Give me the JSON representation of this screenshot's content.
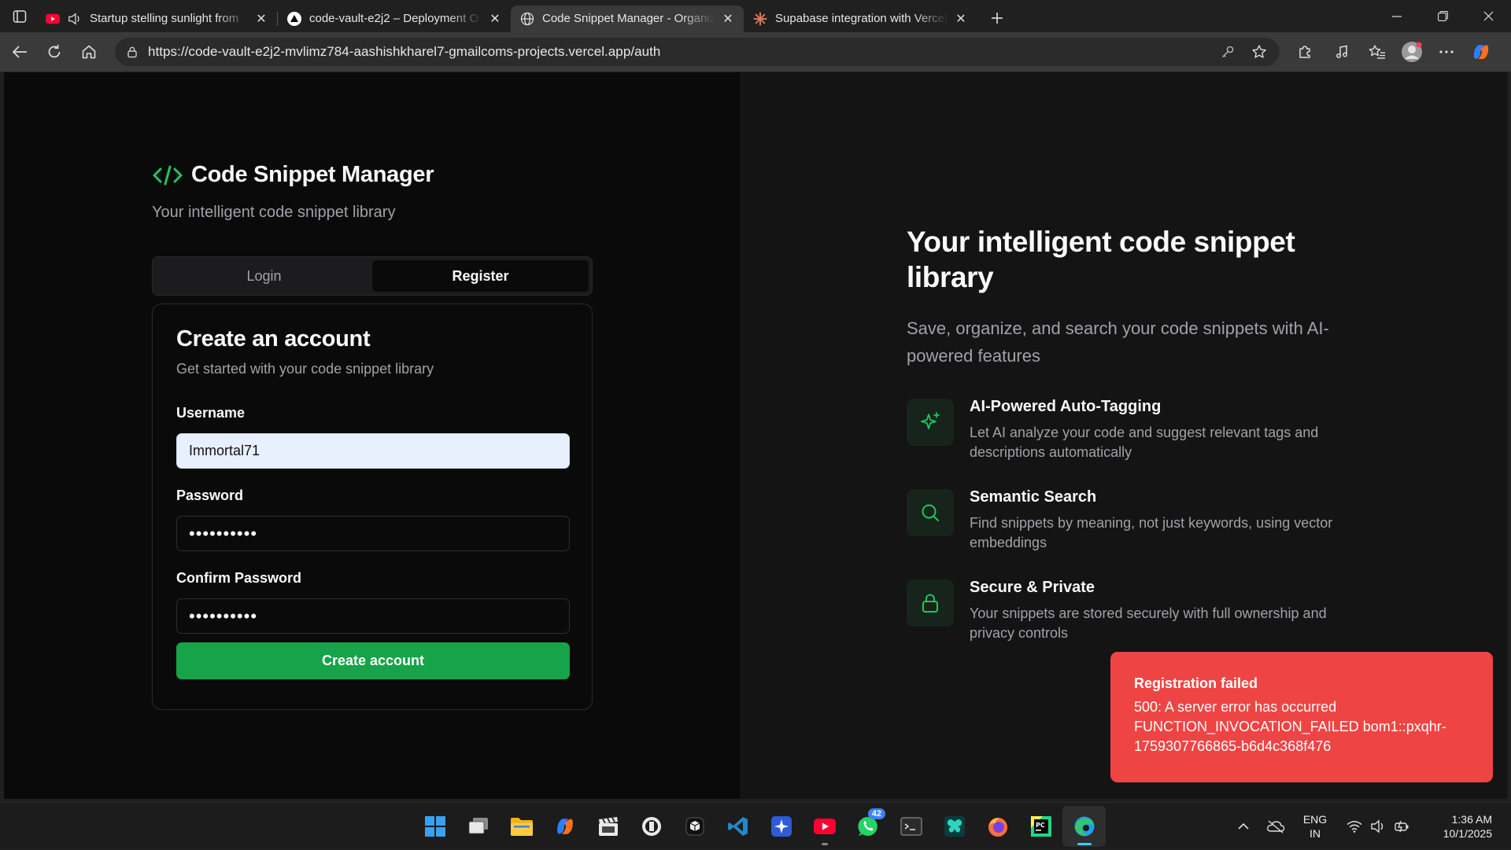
{
  "browser": {
    "tabs": [
      {
        "title": "Startup stelling sunlight from",
        "active": false,
        "icon": "youtube-icon"
      },
      {
        "title": "code-vault-e2j2 – Deployment O",
        "active": false,
        "icon": "vercel-icon"
      },
      {
        "title": "Code Snippet Manager - Organiz",
        "active": true,
        "icon": "globe-icon"
      },
      {
        "title": "Supabase integration with Vercel",
        "active": false,
        "icon": "claude-icon"
      }
    ],
    "url": "https://code-vault-e2j2-mvlimz784-aashishkharel7-gmailcoms-projects.vercel.app/auth"
  },
  "auth": {
    "brand": "Code Snippet Manager",
    "tagline": "Your intelligent code snippet library",
    "tab_login": "Login",
    "tab_register": "Register",
    "card_title": "Create an account",
    "card_subtitle": "Get started with your code snippet library",
    "username_label": "Username",
    "username_value": "Immortal71",
    "password_label": "Password",
    "password_value": "••••••••••",
    "confirm_label": "Confirm Password",
    "confirm_value": "••••••••••",
    "submit_label": "Create account"
  },
  "hero": {
    "title": "Your intelligent code snippet library",
    "subtitle": "Save, organize, and search your code snippets with AI-powered features",
    "features": [
      {
        "title": "AI-Powered Auto-Tagging",
        "desc": "Let AI analyze your code and suggest relevant tags and descriptions automatically",
        "icon": "sparkles-icon"
      },
      {
        "title": "Semantic Search",
        "desc": "Find snippets by meaning, not just keywords, using vector embeddings",
        "icon": "search-icon"
      },
      {
        "title": "Secure & Private",
        "desc": "Your snippets are stored securely with full ownership and privacy controls",
        "icon": "lock-icon"
      }
    ]
  },
  "toast": {
    "title": "Registration failed",
    "message": "500: A server error has occurred FUNCTION_INVOCATION_FAILED bom1::pxqhr-1759307766865-b6d4c368f476"
  },
  "taskbar": {
    "whatsapp_badge": "42",
    "lang_line1": "ENG",
    "lang_line2": "IN",
    "time": "1:36 AM",
    "date": "10/1/2025"
  },
  "colors": {
    "accent_green": "#16a34a",
    "error_red": "#ef4444",
    "muted_text": "#a1a1aa"
  }
}
